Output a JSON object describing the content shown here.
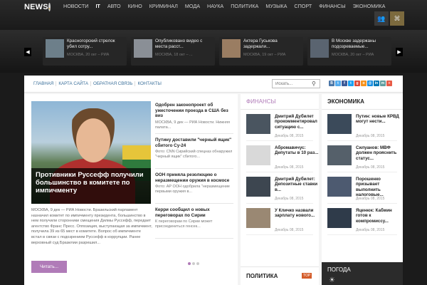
{
  "logo": {
    "text": "NEWS",
    "dot": "."
  },
  "nav": [
    "НОВОСТИ",
    "IT",
    "АВТО",
    "КИНО",
    "КРИМИНАЛ",
    "МОДА",
    "НАУКА",
    "ПОЛИТИКА",
    "МУЗЫКА",
    "СПОРТ",
    "ФИНАНСЫ",
    "ЭКОНОМИКА"
  ],
  "nav_active": "IT",
  "top_icons": [
    "user-icon",
    "rss-icon"
  ],
  "slider": [
    {
      "title": "Красногорский стрелок убил сотру...",
      "meta": "МОСКВА, 20 окт – РИА"
    },
    {
      "title": "Опубликовано видео с места расст...",
      "meta": "МОСКВА, 18 окт – ..."
    },
    {
      "title": "Актера Гуськова задержали...",
      "meta": "МОСКВА, 19 окт – РИА"
    },
    {
      "title": "В Москве задержаны подозреваемые...",
      "meta": "МОСКВА, 20 окт – РИА"
    }
  ],
  "submenu": [
    "ГЛАВНАЯ",
    "КАРТА САЙТА",
    "ОБРАТНАЯ СВЯЗЬ",
    "КОНТАКТЫ"
  ],
  "search": {
    "placeholder": "Искать..."
  },
  "social": [
    {
      "label": "В",
      "color": "#4a76a8"
    },
    {
      "label": "t",
      "color": "#55acee"
    },
    {
      "label": "f",
      "color": "#3b5998"
    },
    {
      "label": "t",
      "color": "#1da1f2"
    },
    {
      "label": "g",
      "color": "#dd4b39"
    },
    {
      "label": "o",
      "color": "#f7931e"
    },
    {
      "label": "@",
      "color": "#168de2"
    },
    {
      "label": "in",
      "color": "#0077b5"
    },
    {
      "label": "m",
      "color": "#5f9ea0"
    },
    {
      "label": "+",
      "color": "#e85b46"
    }
  ],
  "hero": {
    "caption": "Противники Руссефф получили большинство в комитете по импичменту",
    "text": "МОСКВА, 9 дек — РИА Новости. Бразильский парламент назначил комитет по импичменту президента, большинство в нем получили сторонники смещения Дилмы Руссефф, передает агентство Франс Пресс. Оппозиция, выступающая за импичмент, получила 39 из 65 мест в комитете. Вопрос об импичменте встал в связи с подозрением Руссефф в коррупции. Ранее верховный суд Бразилии разрешил...",
    "button": "Читать..."
  },
  "news_list": [
    {
      "title": "Одобрен законопроект об ужесточении проезда в США без виз",
      "body": "МОСКВА, 9 дек — РИА Новости. Нижняя палата..."
    },
    {
      "title": "Путину доставили \"черный ящик\" сбитого Су-24",
      "body": "Фото: CNN Сирийский спецназ обнаружил \"черный ящик\" сбитого..."
    },
    {
      "title": "ООН приняла резолюцию о неразмещении оружия в космосе",
      "body": "Фото: AP ООН одобрила \"неразмещение первыми оружия в..."
    },
    {
      "title": "Керри сообщил о новых переговорах по Сирии",
      "body": "К переговорам по Сирии может присоединиться генсек..."
    }
  ],
  "finance": {
    "title": "ФИНАНСЫ",
    "items": [
      {
        "title": "Дмитрий Дубилет прокомментировал ситуацию с...",
        "date": "Декабрь 08, 2015"
      },
      {
        "title": "Абромавичус: Депутаты в 10 раз...",
        "date": "Декабрь 08, 2015"
      },
      {
        "title": "Дмитрий Дубилет: Депозитные ставки в...",
        "date": "Декабрь 08, 2015"
      },
      {
        "title": "У Кличко назвали зарплату нового...",
        "date": "Декабрь 08, 2015"
      }
    ]
  },
  "politics": {
    "title": "ПОЛИТИКА",
    "badge": "TOP"
  },
  "economy": {
    "title": "ЭКОНОМИКА",
    "items": [
      {
        "title": "Путин: новые КРВД могут нести...",
        "date": "Декабрь 08, 2015"
      },
      {
        "title": "Силуанов: МВФ должен прояснить статус...",
        "date": "Декабрь 08, 2015"
      },
      {
        "title": "Порошенко призывает выполнить налоговые...",
        "date": "Декабрь 08, 2015"
      },
      {
        "title": "Яценюк: Кабмин готов к компромиссу...",
        "date": "Декабрь 08, 2015"
      }
    ]
  },
  "weather": {
    "title": "ПОГОДА"
  }
}
